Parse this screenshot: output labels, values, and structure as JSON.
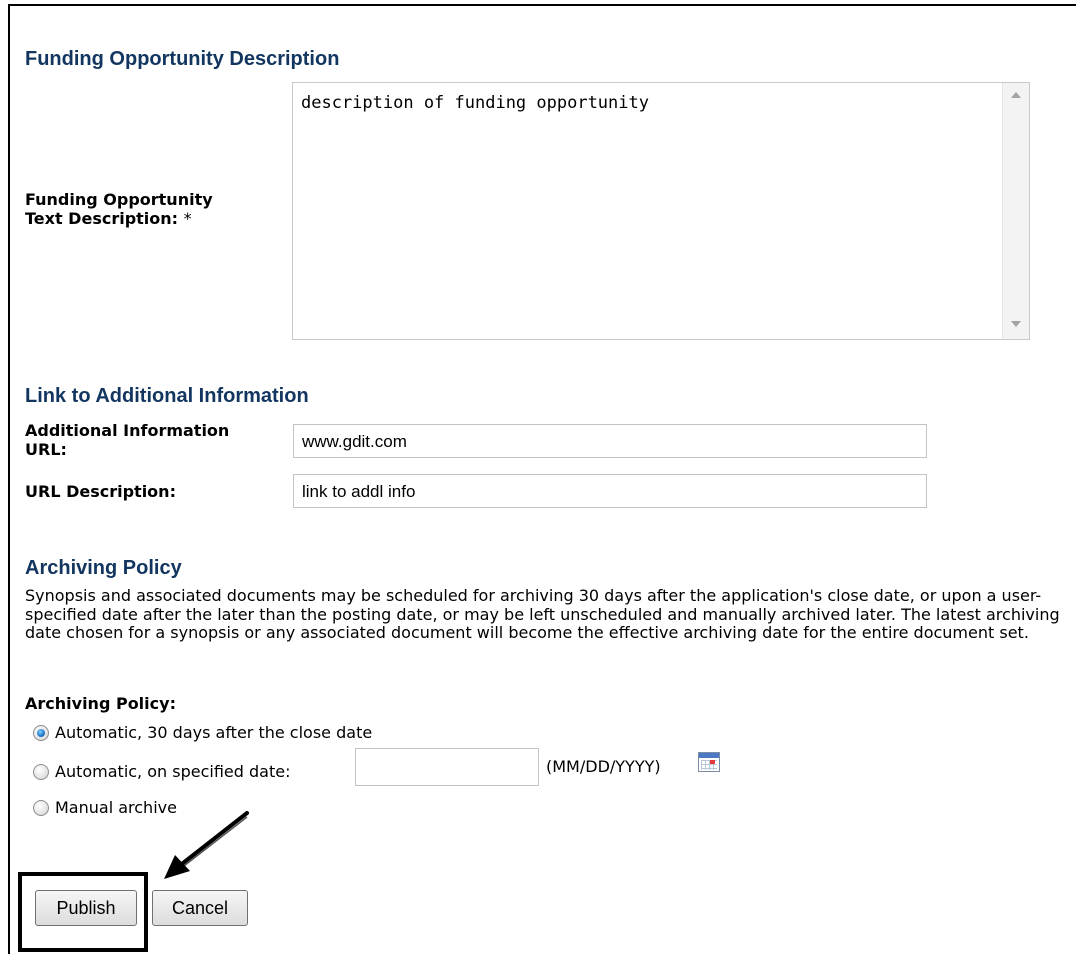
{
  "funding_section": {
    "title": "Funding Opportunity Description",
    "text_label_line1": "Funding Opportunity",
    "text_label_line2": "Text Description:",
    "required_mark": "*",
    "text_value": "description of funding opportunity"
  },
  "link_section": {
    "title": "Link to Additional Information",
    "url_label_line1": "Additional Information",
    "url_label_line2": "URL:",
    "url_value": "www.gdit.com",
    "desc_label": "URL Description:",
    "desc_value": "link to addl info"
  },
  "archiving_section": {
    "title": "Archiving Policy",
    "paragraph": "Synopsis and associated documents may be scheduled for archiving 30 days after the application's close date, or upon a user-specified date after the later than the posting date, or may be left unscheduled and manually archived later. The latest archiving date chosen for a synopsis or any associated document will become the effective archiving date for the entire document set.",
    "policy_label": "Archiving Policy:",
    "options": [
      {
        "label": "Automatic, 30 days after the close date",
        "checked": true
      },
      {
        "label": "Automatic, on specified date:",
        "checked": false
      },
      {
        "label": "Manual archive",
        "checked": false
      }
    ],
    "date_value": "",
    "date_format": "(MM/DD/YYYY)"
  },
  "buttons": {
    "publish": "Publish",
    "cancel": "Cancel"
  },
  "icons": {
    "calendar": "calendar-icon",
    "pointer": "arrow-pointer-icon"
  },
  "colors": {
    "section_title": "#12365f",
    "radio_selected": "#1e74c8"
  }
}
